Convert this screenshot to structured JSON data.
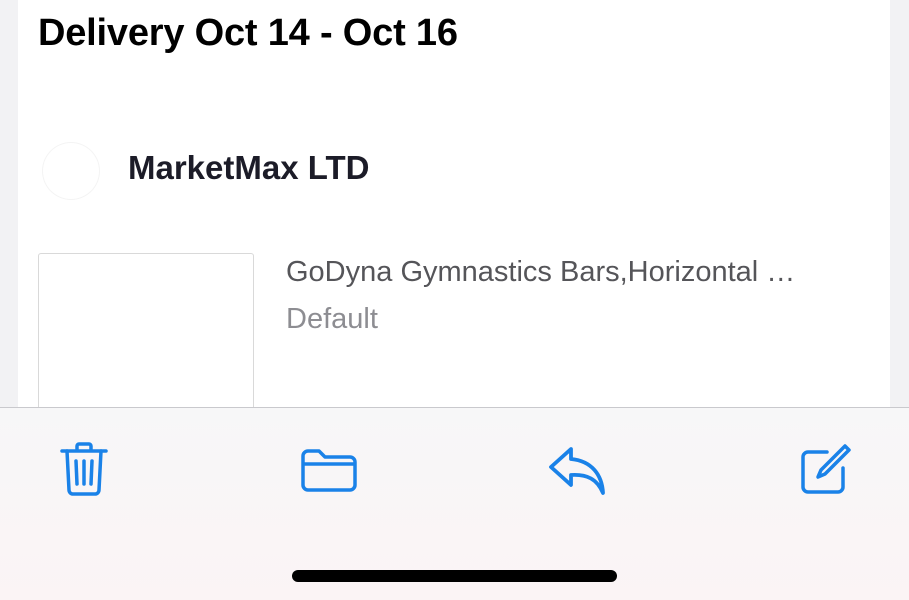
{
  "order": {
    "delivery_label": "Delivery Oct 14 - Oct 16"
  },
  "seller": {
    "name": "MarketMax LTD"
  },
  "product": {
    "title": "GoDyna Gymnastics Bars,Horizontal …",
    "variant": "Default"
  },
  "toolbar": {
    "items": [
      {
        "name": "trash-icon",
        "action": "delete"
      },
      {
        "name": "folder-icon",
        "action": "move"
      },
      {
        "name": "reply-icon",
        "action": "reply"
      },
      {
        "name": "compose-icon",
        "action": "compose"
      }
    ],
    "accent_color": "#1a82e8"
  }
}
